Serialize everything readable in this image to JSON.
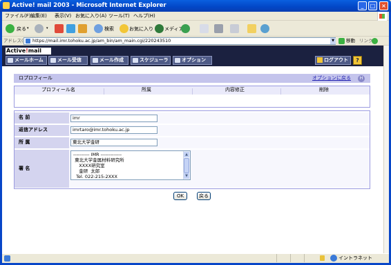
{
  "window": {
    "title": "Active! mail 2003 - Microsoft Internet Explorer"
  },
  "menubar": {
    "items": [
      "ファイル(F)",
      "編集(E)",
      "表示(V)",
      "お気に入り(A)",
      "ツール(T)",
      "ヘルプ(H)"
    ]
  },
  "toolbar": {
    "back": "戻る",
    "search": "検索",
    "favorites": "お気に入り",
    "media": "メディア"
  },
  "address": {
    "label": "アドレス(D)",
    "url": "https://mail.imr.tohoku.ac.jp/am_bin/am_main.cgi/220243510",
    "go": "移動",
    "links": "リンク"
  },
  "app": {
    "logo_part1": "Active",
    "logo_slash": "!",
    "logo_part2": "mail",
    "nav": [
      "メールホーム",
      "メール受信",
      "メール作成",
      "スケジューラ",
      "オプション"
    ],
    "logout": "ログアウト",
    "help": "?"
  },
  "profile": {
    "title": "ロプロフィール",
    "back_link": "オプションに戻る",
    "columns": [
      "プロフィール名",
      "所属",
      "内容修正",
      "削除"
    ]
  },
  "form": {
    "name_label": "名 前",
    "name_value": "imr",
    "email_label": "返信アドレス",
    "email_value": "imrtaro@imr.tohoku.ac.jp",
    "affil_label": "所 属",
    "affil_value": "東北大学金研",
    "sig_label": "署 名",
    "sig_value": "---------- IMR -------------\n 東北大学金属材料研究所\n    XXXX研究室\n    金研  太郎\n  Tel. 022-215-2XXX"
  },
  "buttons": {
    "ok": "OK",
    "back": "戻る"
  },
  "statusbar": {
    "zone": "イントラネット"
  }
}
